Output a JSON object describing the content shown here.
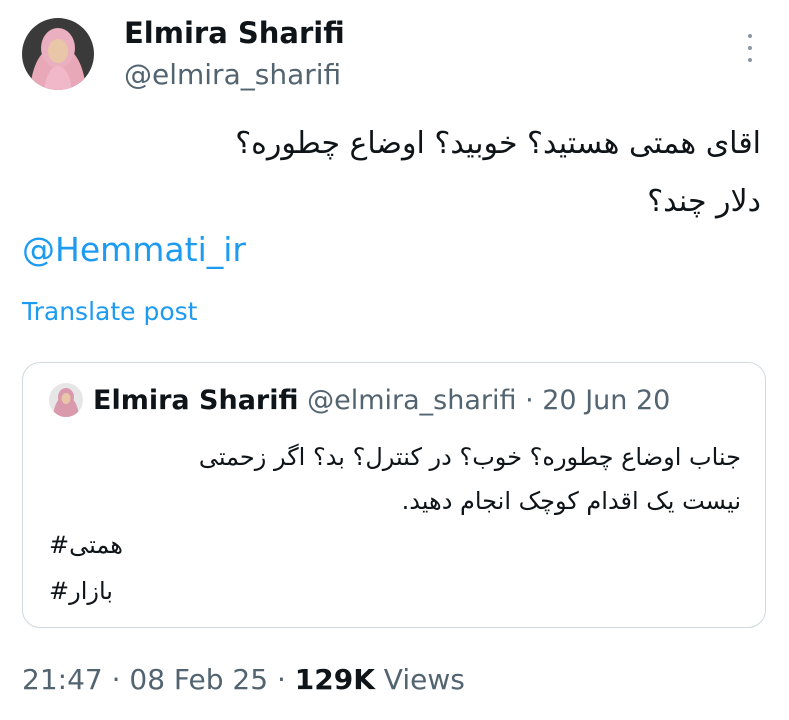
{
  "post": {
    "author_name": "Elmira Sharifi",
    "author_handle": "@elmira_sharifi",
    "text_line1": "اقای همتی هستید؟ خوبید؟ اوضاع چطوره؟",
    "text_line2": "دلار چند؟",
    "mention": "@Hemmati_ir",
    "translate_label": "Translate post",
    "more_icon": "more-horizontal-icon"
  },
  "quote": {
    "author_name": "Elmira Sharifi",
    "author_handle": "@elmira_sharifi",
    "separator": " · ",
    "date": "20 Jun 20",
    "text_line1": "جناب اوضاع چطوره؟ خوب؟ در کنترل؟ بد؟ اگر زحمتی",
    "text_line2": "نیست یک اقدام کوچک انجام دهید.",
    "hashtag1": "همتی#",
    "hashtag2": "بازار#"
  },
  "footer": {
    "time": "21:47",
    "sep1": " · ",
    "date": "08 Feb 25",
    "sep2": " · ",
    "views_count": "129K",
    "views_label": " Views"
  },
  "colors": {
    "link": "#1d9bf0",
    "secondary_text": "#536471",
    "primary_text": "#0f1419",
    "border": "#cfd9de",
    "avatar_scarf": "#e8a8b8"
  }
}
